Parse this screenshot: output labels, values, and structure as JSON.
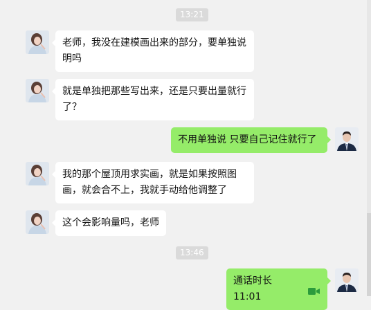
{
  "timestamps": [
    "13:21",
    "13:46"
  ],
  "messages": [
    {
      "side": "left",
      "text": "老师，我没在建模画出来的部分，要单独说明吗"
    },
    {
      "side": "left",
      "text": "就是单独把那些写出来，还是只要出量就行了？"
    },
    {
      "side": "right",
      "text": "不用单独说  只要自己记住就行了"
    },
    {
      "side": "left",
      "text": "我的那个屋顶用求实画，就是如果按照图画，就会合不上，我就手动给他调整了"
    },
    {
      "side": "left",
      "text": "这个会影响量吗，老师"
    },
    {
      "side": "right",
      "text": "通话时长 11:01",
      "type": "call",
      "icon": "video-call-icon"
    }
  ],
  "colors": {
    "background": "#f1f1f1",
    "incoming_bubble": "#ffffff",
    "outgoing_bubble": "#95ec69",
    "call_icon": "#2c9b3c",
    "timestamp_pill": "#dadada"
  }
}
